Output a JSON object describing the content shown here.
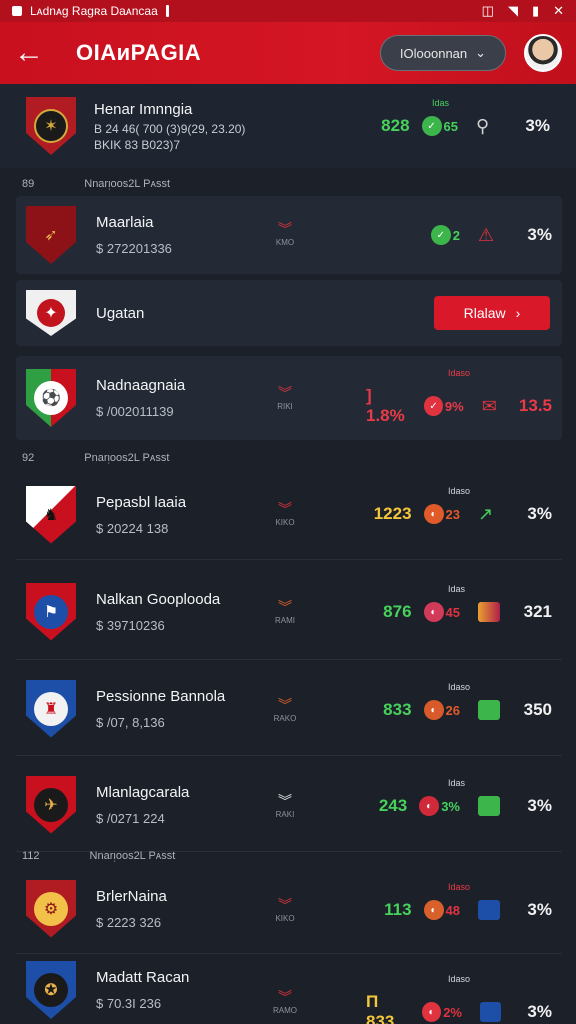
{
  "status_bar": {
    "app_text": "Lᴀdnᴀg Ragʀa Daᴀncaa"
  },
  "header": {
    "title": "OIAᴎPAGIA",
    "dropdown_label": "IOlooonnan",
    "dropdown_icon": "chevron-down-icon"
  },
  "sections": [
    {
      "num": "89",
      "label": "Nnarᴉoos2L Pᴀsst"
    },
    {
      "num": "92",
      "label": "Pnarᴉoos2L Pᴀsst"
    },
    {
      "num": "112",
      "label": "Nnarᴉoos2L Pᴀsst"
    }
  ],
  "follow_button": {
    "label": "Rlalaw",
    "arrow": "›"
  },
  "teams": [
    {
      "name": "Henar Imnngia",
      "line1": "B 24 46( 700 (3)9(29, 23.20)",
      "line2": "BKIK 83 B023)7",
      "head": "Idas",
      "value": "828",
      "value_color": "green",
      "circle": "65",
      "circle_color": "#3cb54a",
      "end": "3%"
    },
    {
      "name": "Maarlaia",
      "price": "$ 272201336",
      "trend_small": "KMO",
      "value": "",
      "circle": "2",
      "circle_color": "#3cb54a",
      "end": "3%"
    },
    {
      "name": "Ugatan"
    },
    {
      "name": "Nadnaagnaia",
      "price": "$ /002011139",
      "trend_small": "RIKI",
      "head": "Idaso",
      "value": "] 1.8%",
      "value_color": "red",
      "circle": "9%",
      "circle_color": "#e0333f",
      "end": "13.5"
    },
    {
      "name": "Pepasbl laaia",
      "price": "$ 20224 138",
      "trend_small": "KIKO",
      "head": "Idaso",
      "value": "1223",
      "value_color": "yellow",
      "circle": "23",
      "circle_color": "#e05a2a",
      "end": "3%"
    },
    {
      "name": "Nalkan Gooplooda",
      "price": "$ 39710236",
      "trend_small": "RAMI",
      "head": "Idas",
      "value": "876",
      "value_color": "green",
      "circle": "45",
      "circle_color": "#d23a5a",
      "end": "321"
    },
    {
      "name": "Pessionne Bannola",
      "price": "$ /07, 8,136",
      "trend_small": "RAKO",
      "head": "Idaso",
      "value": "833",
      "value_color": "green",
      "circle": "26",
      "circle_color": "#d85a2a",
      "end": "350"
    },
    {
      "name": "Mlanlagcarala",
      "price": "$ /0271 224",
      "trend_small": "RAKI",
      "head": "Idas",
      "value": "243",
      "value_color": "green",
      "circle": "3%",
      "circle_color": "#d02a3a",
      "end": "3%"
    },
    {
      "name": "BrlerNaina",
      "price": "$ 2223 326",
      "trend_small": "KIKO",
      "head": "Idaso",
      "value": "113",
      "value_color": "green",
      "circle": "48",
      "circle_color": "#d8602a",
      "end": "3%"
    },
    {
      "name": "Madatt Racan",
      "price": "$ 70.3I 236",
      "trend_small": "RAMO",
      "head": "Idaso",
      "value": "Π 833",
      "value_color": "yellow",
      "circle": "2%",
      "circle_color": "#e0333f",
      "end": "3%"
    }
  ]
}
